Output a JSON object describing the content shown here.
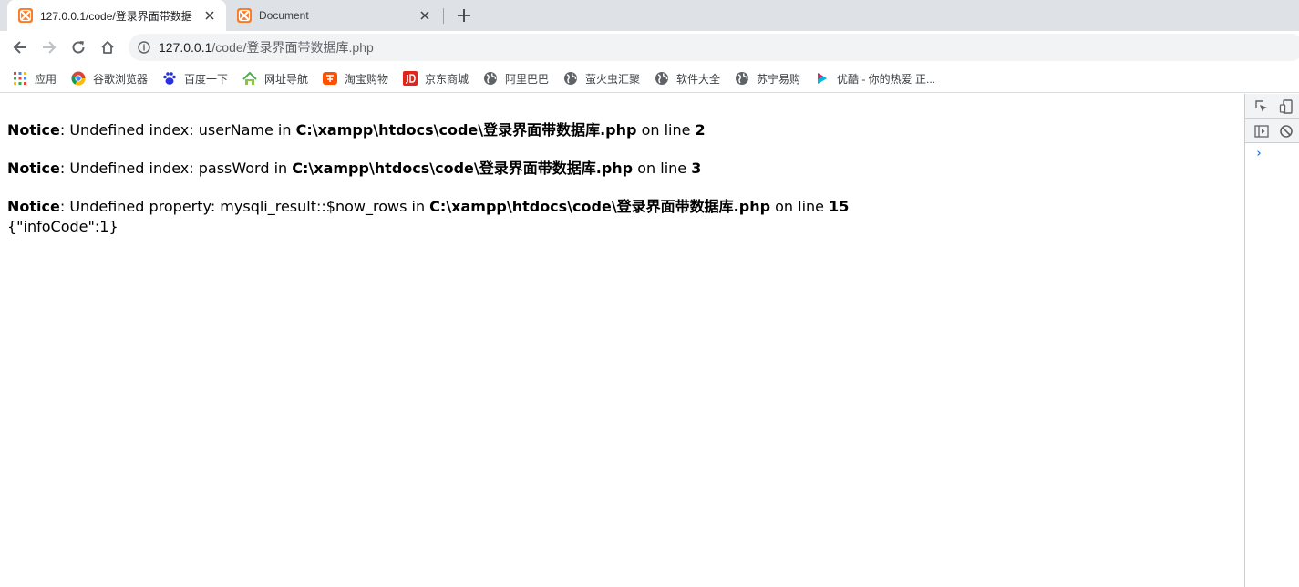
{
  "tabs": [
    {
      "title": "127.0.0.1/code/登录界面带数据",
      "active": true,
      "favicon": "xampp-icon"
    },
    {
      "title": "Document",
      "active": false,
      "favicon": "xampp-icon"
    }
  ],
  "toolbar": {
    "url_host": "127.0.0.1",
    "url_path": "/code/登录界面带数据库.php"
  },
  "bookmarks": [
    {
      "label": "应用",
      "icon": "apps-grid-icon"
    },
    {
      "label": "谷歌浏览器",
      "icon": "chrome-icon"
    },
    {
      "label": "百度一下",
      "icon": "baidu-paw-icon"
    },
    {
      "label": "网址导航",
      "icon": "2345-nav-icon"
    },
    {
      "label": "淘宝购物",
      "icon": "taobao-icon"
    },
    {
      "label": "京东商城",
      "icon": "jd-icon"
    },
    {
      "label": "阿里巴巴",
      "icon": "globe-icon"
    },
    {
      "label": "萤火虫汇聚",
      "icon": "globe-icon"
    },
    {
      "label": "软件大全",
      "icon": "globe-icon"
    },
    {
      "label": "苏宁易购",
      "icon": "globe-icon"
    },
    {
      "label": "优酷 - 你的热爱 正...",
      "icon": "youku-icon"
    }
  ],
  "notices": [
    {
      "label": "Notice",
      "message": ": Undefined index: userName in ",
      "file": "C:\\xampp\\htdocs\\code\\登录界面带数据库.php",
      "on_line": " on line ",
      "line": "2"
    },
    {
      "label": "Notice",
      "message": ": Undefined index: passWord in ",
      "file": "C:\\xampp\\htdocs\\code\\登录界面带数据库.php",
      "on_line": " on line ",
      "line": "3"
    },
    {
      "label": "Notice",
      "message": ": Undefined property: mysqli_result::$now_rows in ",
      "file": "C:\\xampp\\htdocs\\code\\登录界面带数据库.php",
      "on_line": " on line ",
      "line": "15"
    }
  ],
  "json_output": "{\"infoCode\":1}",
  "devtools": {
    "prompt": "›"
  },
  "colors": {
    "tabstrip_bg": "#dee1e6",
    "omnibox_bg": "#f1f3f4",
    "xampp_orange": "#fb7a24",
    "jd_red": "#e1251b",
    "prompt_blue": "#1a73e8"
  }
}
